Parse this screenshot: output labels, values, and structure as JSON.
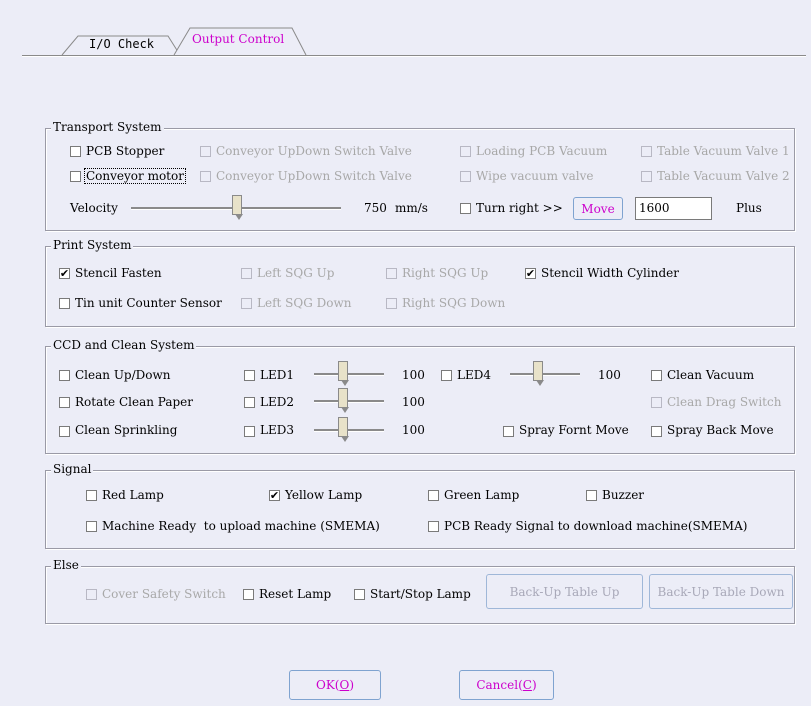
{
  "tabs": [
    {
      "label": "I/O Check",
      "active": false
    },
    {
      "label": "Output Control",
      "active": true
    }
  ],
  "transport": {
    "title": "Transport System",
    "pcb_stopper": {
      "label": "PCB Stopper",
      "checked": false
    },
    "conveyor_motor": {
      "label": "Conveyor motor",
      "checked": false
    },
    "conveyor_updown_1": {
      "label": "Conveyor UpDown Switch Valve",
      "disabled": true
    },
    "conveyor_updown_2": {
      "label": "Conveyor UpDown Switch Valve",
      "disabled": true
    },
    "loading_vacuum": {
      "label": "Loading PCB Vacuum",
      "disabled": true
    },
    "wipe_vacuum": {
      "label": "Wipe vacuum valve",
      "disabled": true
    },
    "table_vacuum_1": {
      "label": "Table Vacuum Valve 1",
      "disabled": true
    },
    "table_vacuum_2": {
      "label": "Table Vacuum Valve 2",
      "disabled": true
    },
    "velocity_label": "Velocity",
    "velocity_value": "750",
    "velocity_unit": "mm/s",
    "turn_right": {
      "label": "Turn right >>",
      "checked": false
    },
    "move_button": "Move",
    "plus_value": "1600",
    "plus_label": "Plus"
  },
  "print": {
    "title": "Print System",
    "stencil_fasten": {
      "label": "Stencil Fasten",
      "checked": true
    },
    "tin_unit": {
      "label": "Tin unit Counter Sensor",
      "checked": false
    },
    "left_sqg_up": {
      "label": "Left SQG Up",
      "disabled": true
    },
    "left_sqg_down": {
      "label": "Left SQG Down",
      "disabled": true
    },
    "right_sqg_up": {
      "label": "Right SQG Up",
      "disabled": true
    },
    "right_sqg_down": {
      "label": "Right SQG Down",
      "disabled": true
    },
    "stencil_width": {
      "label": "Stencil Width Cylinder",
      "checked": true
    }
  },
  "ccd": {
    "title": "CCD and Clean System",
    "clean_updown": {
      "label": "Clean Up/Down",
      "checked": false
    },
    "rotate_paper": {
      "label": "Rotate Clean Paper",
      "checked": false
    },
    "clean_sprinkling": {
      "label": "Clean Sprinkling",
      "checked": false
    },
    "led1": {
      "label": "LED1",
      "checked": false,
      "value": "100"
    },
    "led2": {
      "label": "LED2",
      "checked": false,
      "value": "100"
    },
    "led3": {
      "label": "LED3",
      "checked": false,
      "value": "100"
    },
    "led4": {
      "label": "LED4",
      "checked": false,
      "value": "100"
    },
    "clean_vacuum": {
      "label": "Clean Vacuum",
      "checked": false
    },
    "clean_drag": {
      "label": "Clean Drag Switch",
      "disabled": true
    },
    "spray_front": {
      "label": "Spray Fornt Move",
      "checked": false
    },
    "spray_back": {
      "label": "Spray Back Move",
      "checked": false
    }
  },
  "signal": {
    "title": "Signal",
    "red_lamp": {
      "label": "Red Lamp",
      "checked": false
    },
    "yellow_lamp": {
      "label": "Yellow Lamp",
      "checked": true
    },
    "green_lamp": {
      "label": "Green Lamp",
      "checked": false
    },
    "buzzer": {
      "label": "Buzzer",
      "checked": false
    },
    "machine_ready": {
      "label": "Machine Ready  to upload machine (SMEMA)",
      "checked": false
    },
    "pcb_ready": {
      "label": "PCB Ready Signal to download machine(SMEMA)",
      "checked": false
    }
  },
  "else": {
    "title": "Else",
    "cover_safety": {
      "label": "Cover Safety Switch",
      "disabled": true
    },
    "reset_lamp": {
      "label": "Reset Lamp",
      "checked": false
    },
    "start_stop": {
      "label": "Start/Stop Lamp",
      "checked": false
    },
    "backup_up": "Back-Up Table Up",
    "backup_down": "Back-Up Table Down"
  },
  "footer": {
    "ok_text": "OK",
    "ok_key": "O",
    "cancel_text": "Cancel",
    "cancel_key": "C"
  },
  "colors": {
    "window_bg": "#ecedf7",
    "active_tab_text": "#cc00cc",
    "button_border": "#7fa3d0",
    "disabled_text": "#a8a8a8"
  }
}
